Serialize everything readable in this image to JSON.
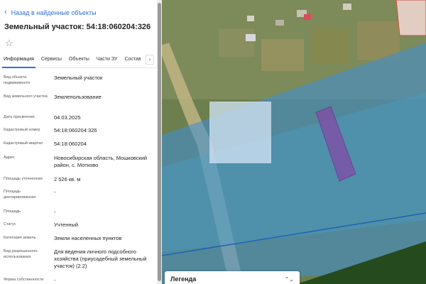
{
  "panel": {
    "back_label": "Назад в найденные объекты",
    "title": "Земельный участок: 54:18:060204:326",
    "tabs": [
      "Информация",
      "Сервисы",
      "Объекты",
      "Части ЗУ",
      "Состав"
    ],
    "active_tab": "Информация",
    "rows": [
      {
        "label": "Вид объекта недвижимости",
        "value": "Земельный участок"
      },
      {
        "label": "Вид земельного участка",
        "value": "Землепользование"
      },
      {
        "label": "Дата присвоения",
        "value": "04.03.2025"
      },
      {
        "label": "Кадастровый номер",
        "value": "54:18:060204:326"
      },
      {
        "label": "Кадастровый квартал",
        "value": "54:18:060204"
      },
      {
        "label": "Адрес",
        "value": "Новосибирская область, Мошковский район, с. Мотково"
      },
      {
        "label": "Площадь уточненная",
        "value": "2 526 кв. м"
      },
      {
        "label": "Площадь декларированная",
        "value": "-"
      },
      {
        "label": "Площадь",
        "value": "-"
      },
      {
        "label": "Статус",
        "value": "Учтенный"
      },
      {
        "label": "Категория земель",
        "value": "Земли населенных пунктов"
      },
      {
        "label": "Вид разрешенного использования",
        "value": "Для ведения личного подсобного хозяйства (приусадебный земельный участок) (2.2)"
      },
      {
        "label": "Форма собственности",
        "value": "-"
      }
    ]
  },
  "map": {
    "legend_label": "Легенда",
    "colors": {
      "zone_blue": "#3d8fd9",
      "parcel_purple": "#8a3fa8",
      "highlight": "#ffffff",
      "parcel_red": "#e0403a"
    }
  }
}
